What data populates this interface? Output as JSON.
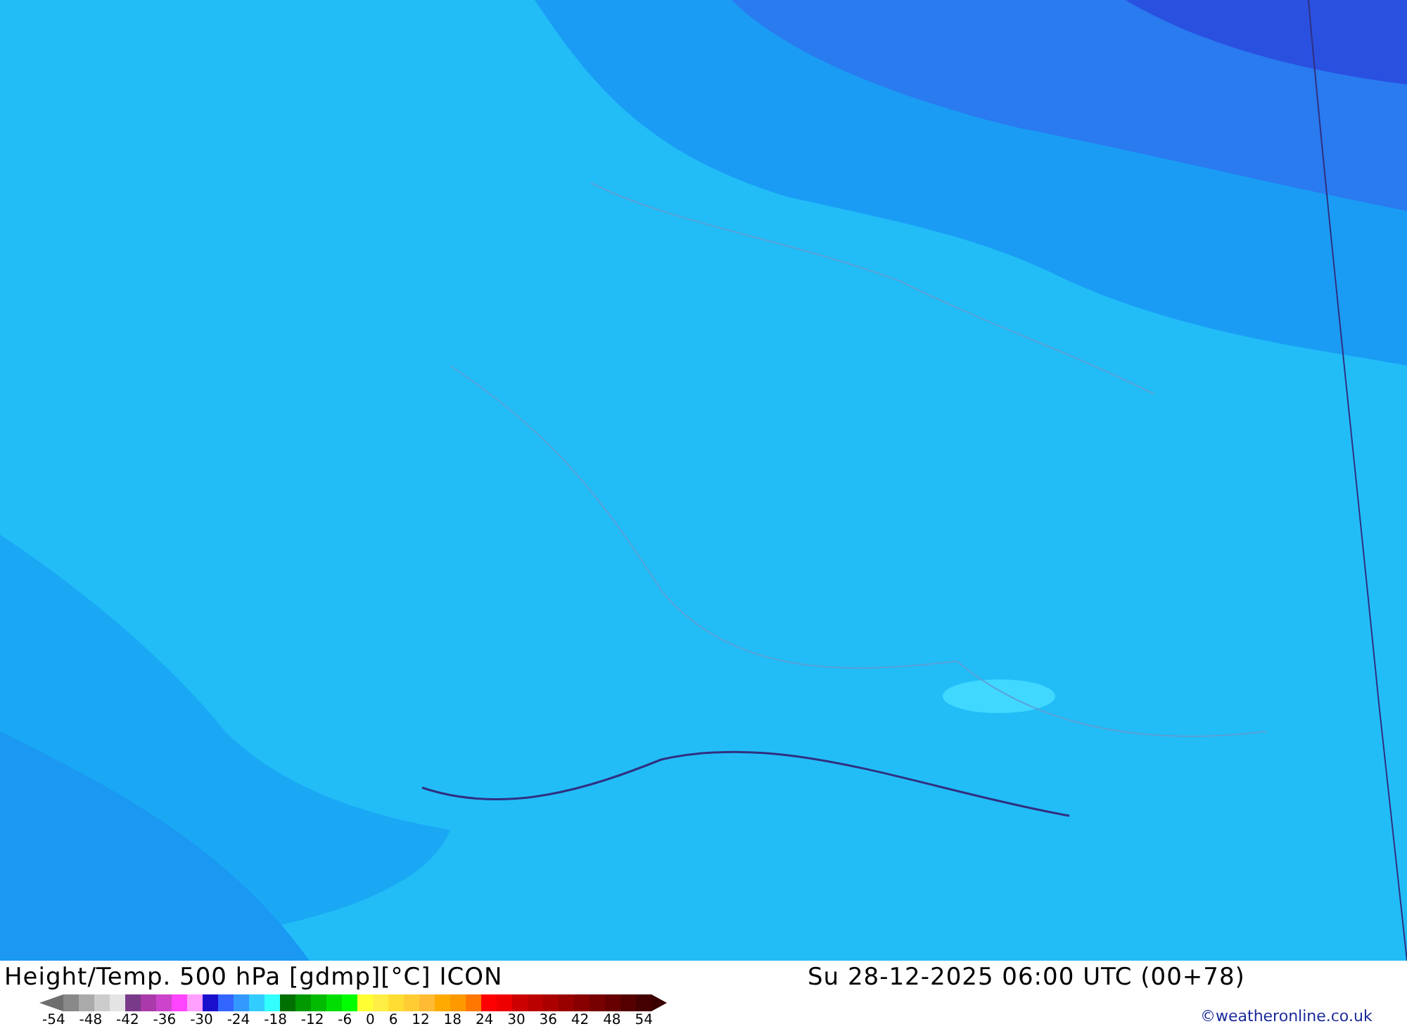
{
  "footer": {
    "title": "Height/Temp. 500 hPa [gdmp][°C] ICON",
    "datetime": "Su 28-12-2025 06:00 UTC (00+78)",
    "credit": "©weatheronline.co.uk",
    "colorbar": {
      "low_end": {
        "color": "#6e6e6e"
      },
      "high_end": {
        "color": "#3a0000"
      },
      "swatches": [
        {
          "color": "#888888"
        },
        {
          "color": "#aaaaaa"
        },
        {
          "color": "#cccccc"
        },
        {
          "color": "#e4e4e4"
        },
        {
          "color": "#7a3a8a"
        },
        {
          "color": "#aa3aaa"
        },
        {
          "color": "#cc44cc"
        },
        {
          "color": "#ff44ff"
        },
        {
          "color": "#ffa0ff"
        },
        {
          "color": "#1a10cc"
        },
        {
          "color": "#3366ff"
        },
        {
          "color": "#3399ff"
        },
        {
          "color": "#33ccff"
        },
        {
          "color": "#33ffff"
        },
        {
          "color": "#007000"
        },
        {
          "color": "#009900"
        },
        {
          "color": "#00bb00"
        },
        {
          "color": "#00dd00"
        },
        {
          "color": "#00ff00"
        },
        {
          "color": "#ffff33"
        },
        {
          "color": "#ffee44"
        },
        {
          "color": "#ffdd33"
        },
        {
          "color": "#ffcc33"
        },
        {
          "color": "#ffbb33"
        },
        {
          "color": "#ffaa00"
        },
        {
          "color": "#ff9900"
        },
        {
          "color": "#ff7700"
        },
        {
          "color": "#ff0000"
        },
        {
          "color": "#ee0000"
        },
        {
          "color": "#cc0000"
        },
        {
          "color": "#bb0000"
        },
        {
          "color": "#aa0000"
        },
        {
          "color": "#990000"
        },
        {
          "color": "#880000"
        },
        {
          "color": "#770000"
        },
        {
          "color": "#660000"
        },
        {
          "color": "#550000"
        },
        {
          "color": "#440000"
        }
      ],
      "labels": [
        "-54",
        "-48",
        "-42",
        "-36",
        "-30",
        "-24",
        "-18",
        "-12",
        "-6",
        "0",
        "6",
        "12",
        "18",
        "24",
        "30",
        "36",
        "42",
        "48",
        "54"
      ]
    }
  }
}
